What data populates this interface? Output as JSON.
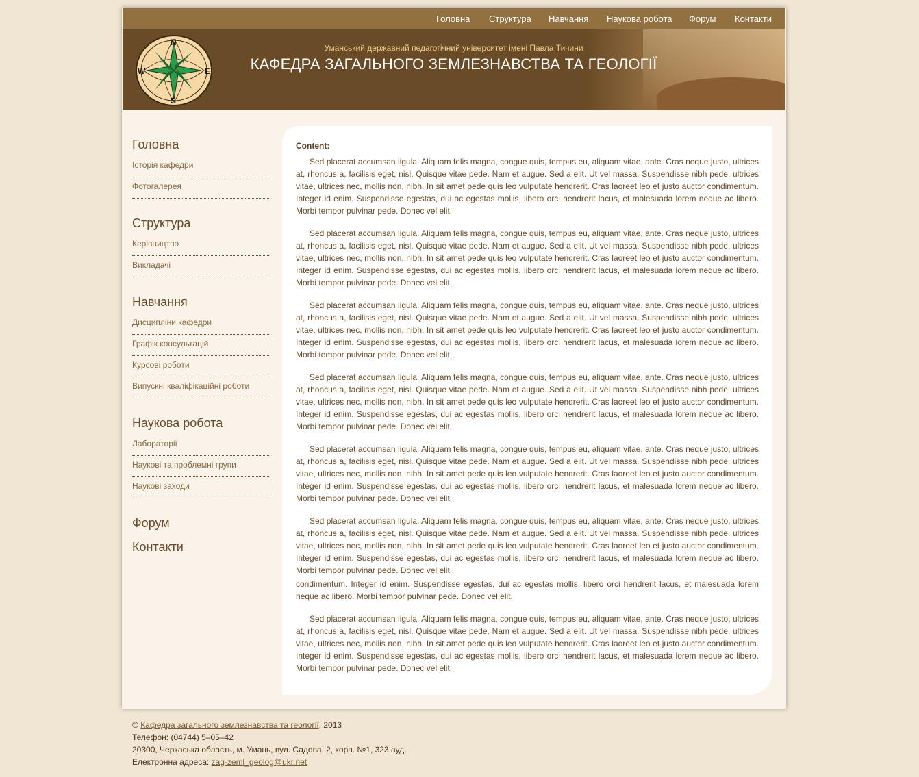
{
  "nav": {
    "items": [
      {
        "label": "Головна"
      },
      {
        "label": "Структура"
      },
      {
        "label": "Навчання"
      },
      {
        "label": "Наукова робота"
      },
      {
        "label": "Форум"
      },
      {
        "label": "Контакти"
      }
    ]
  },
  "header": {
    "university": "Уманський державний педагогічний університет імені Павла Тичини",
    "title": "КАФЕДРА ЗАГАЛЬНОГО ЗЕМЛЕЗНАВСТВА ТА ГЕОЛОГІЇ",
    "compass": {
      "n": "N",
      "s": "S",
      "w": "W",
      "e": "E"
    },
    "colors": {
      "nav_bg": "#93703f",
      "banner_bg": "#6a4b27",
      "compass_star": "#2e9a4a"
    }
  },
  "sidebar": {
    "sections": [
      {
        "heading": "Головна",
        "links": [
          "Історія кафедри",
          "Фотогалерея"
        ]
      },
      {
        "heading": "Структура",
        "links": [
          "Керівництво",
          "Викладачі"
        ]
      },
      {
        "heading": "Навчання",
        "links": [
          "Дисципліни кафедри",
          "Графік консультацій",
          "Курсові роботи",
          "Випускні кваліфікаційні роботи"
        ]
      },
      {
        "heading": "Наукова робота",
        "links": [
          "Лабораторії",
          "Наукові та проблемні групи",
          "Наукові заходи"
        ]
      },
      {
        "heading": "Форум",
        "links": []
      },
      {
        "heading": "Контакти",
        "links": []
      }
    ]
  },
  "content": {
    "label": "Content:",
    "paragraph": "Sed placerat accumsan ligula. Aliquam felis magna, congue quis, tempus eu, aliquam vitae, ante. Cras neque justo, ultrices at, rhoncus a, facilisis eget, nisl. Quisque vitae pede. Nam et augue. Sed a elit. Ut vel massa. Suspendisse nibh pede, ultrices vitae, ultrices nec, mollis non, nibh. In sit amet pede quis leo vulputate hendrerit. Cras laoreet leo et justo auctor condimentum. Integer id enim. Suspendisse egestas, dui ac egestas mollis, libero orci hendrerit lacus, et malesuada lorem neque ac libero. Morbi tempor pulvinar pede. Donec vel elit.",
    "fragment": "condimentum. Integer id enim. Suspendisse egestas, dui ac egestas mollis, libero orci hendrerit lacus, et malesuada lorem neque ac libero. Morbi tempor pulvinar pede. Donec vel elit."
  },
  "footer": {
    "copyright_symbol": "©",
    "copyright_link": "Кафедра загального землезнавства та геології",
    "copyright_year": ", 2013",
    "phone": "Телефон: (04744) 5–05–42",
    "address": "20300, Черкаська область, м. Умань, вул. Садова, 2, корп. №1, 323 ауд.",
    "email_label": "Електронна адреса:",
    "email": "zag-zeml_geolog@ukr.net"
  }
}
